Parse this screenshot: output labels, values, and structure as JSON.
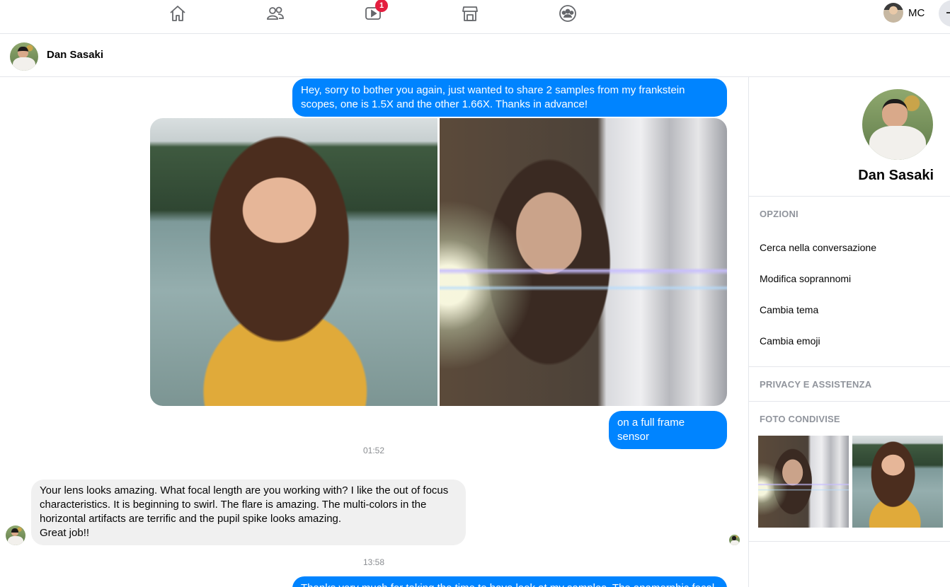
{
  "topnav": {
    "notification_count": "1",
    "profile_name": "MC",
    "icons": [
      "home-icon",
      "friends-icon",
      "watch-icon",
      "marketplace-icon",
      "groups-icon"
    ]
  },
  "conversation": {
    "contact_name": "Dan Sasaki"
  },
  "messages": {
    "out_1": "Hey, sorry to bother you again, just wanted to share 2 samples from my frankstein scopes, one is 1.5X and the other 1.66X. Thanks in advance!",
    "out_2": "on a full frame sensor",
    "stamp_1": "01:52",
    "in_1_line1": "Your lens looks amazing. What focal length are you working with? I like the out of focus",
    "in_1_line2": "characteristics.  It is beginning to swirl.  The flare is amazing.  The multi-colors in the",
    "in_1_line3": "horizontal artifacts are terrific and the pupil spike looks amazing.",
    "in_1_line4": "Great job!!",
    "stamp_2": "13:58",
    "out_3": "Thanks very much for taking the time to have look at my samples. The anamorphic focal"
  },
  "sidebar": {
    "contact_name": "Dan Sasaki",
    "options_title": "OPZIONI",
    "options": [
      "Cerca nella conversazione",
      "Modifica soprannomi",
      "Cambia tema",
      "Cambia emoji"
    ],
    "privacy_title": "PRIVACY E ASSISTENZA",
    "shared_photos_title": "FOTO CONDIVISE"
  },
  "colors": {
    "outgoing_bubble": "#0084ff",
    "incoming_bubble": "#f0f0f0",
    "badge": "#e41e3f"
  }
}
